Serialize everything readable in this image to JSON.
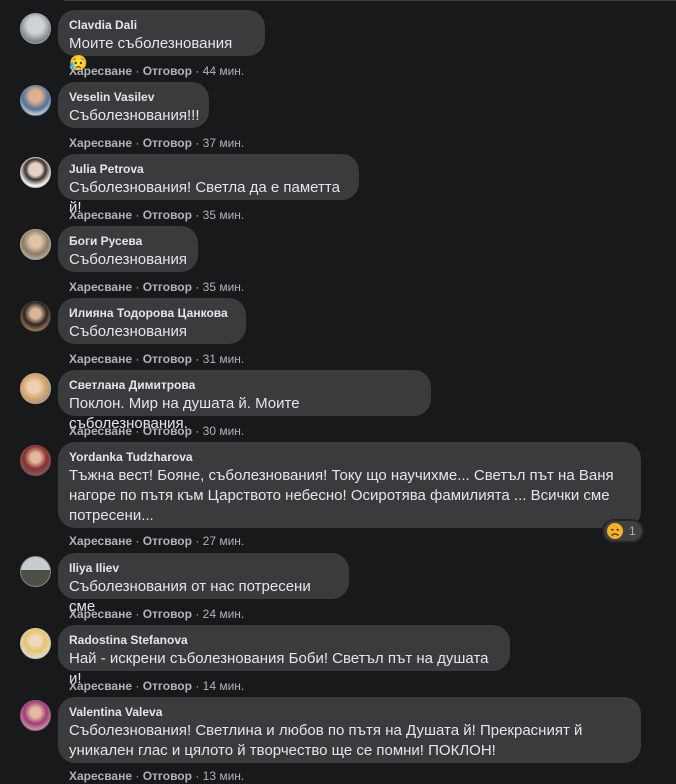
{
  "actions": {
    "like": "Харесване",
    "reply": "Отговор",
    "sep": "·"
  },
  "comments": [
    {
      "author": "Clavdia Dali",
      "text": "Моите съболезнования 😥",
      "time": "44 мин.",
      "avatar_color": "#9aa1a6"
    },
    {
      "author": "Veselin Vasilev",
      "text": "Съболезнования!!!",
      "time": "37 мин.",
      "avatar_color": "#6f86a8"
    },
    {
      "author": "Julia Petrova",
      "text": "Съболезнования! Светла да е паметта й!",
      "time": "35 мин.",
      "avatar_color": "#c9c2b8"
    },
    {
      "author": "Боги Русева",
      "text": "Съболезнования",
      "time": "35 мин.",
      "avatar_color": "#b8a38e"
    },
    {
      "author": "Илияна Тодорова Цанкова",
      "text": "Съболезнования",
      "time": "31 мин.",
      "avatar_color": "#4a3a30"
    },
    {
      "author": "Светлана Димитрова",
      "text": "Поклон. Мир на душата й. Моите съболезнования.",
      "time": "30 мин.",
      "avatar_color": "#c7a58a"
    },
    {
      "author": "Yordanka Tudzharova",
      "text_lines": [
        "Тъжна вест! Бояне, съболезнования! Току що научихме... Светъл път на Ваня",
        "нагоре по пътя към Царството небесно! Осиротява фамилията ... Всички сме",
        "потресени..."
      ],
      "time": "27 мин.",
      "avatar_color": "#8a4a4a",
      "reaction_count": "1"
    },
    {
      "author": "Iliya Iliev",
      "text": "Съболезнования от нас потресени сме",
      "time": "24 мин.",
      "avatar_color": "#7f8a80"
    },
    {
      "author": "Radostina Stefanova",
      "text": "Най - искрени съболезнования Боби! Светъл път на душата и!",
      "time": "14 мин.",
      "avatar_color": "#d9c7a0"
    },
    {
      "author": "Valentina Valeva",
      "text_lines": [
        "Съболезнования! Светлина и любов по пътя на Душата й! Прекрасният й",
        "уникален глас и цялото й творчество ще се помни! ПОКЛОН!"
      ],
      "time": "13 мин.",
      "avatar_color": "#9a5a8a"
    }
  ]
}
